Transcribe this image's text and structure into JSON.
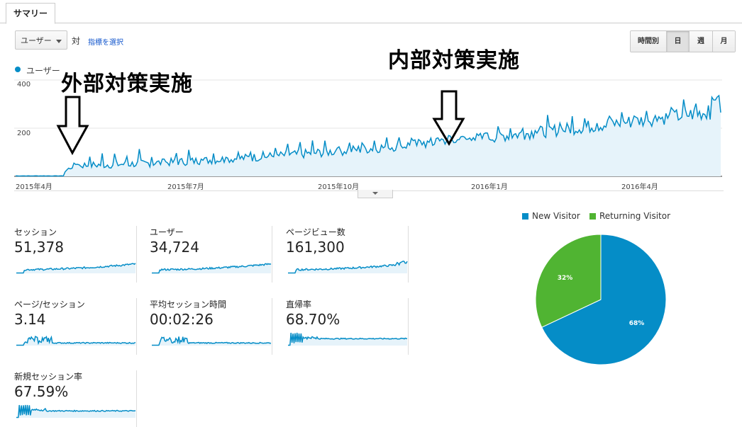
{
  "tabs": [
    {
      "label": "サマリー"
    }
  ],
  "toolbar": {
    "metric_select": "ユーザー",
    "vs_label": "対",
    "choose_metric_link": "指標を選択",
    "periods": [
      "時間別",
      "日",
      "週",
      "月"
    ],
    "active_period": "日"
  },
  "colors": {
    "line": "#058dc7",
    "fill": "#e6f3fa",
    "new_visitor": "#058dc7",
    "returning_visitor": "#50b432"
  },
  "main_chart": {
    "legend": "ユーザー",
    "y_ticks": [
      "400",
      "200"
    ],
    "x_ticks": [
      "2015年4月",
      "2015年7月",
      "2015年10月",
      "2016年1月",
      "2016年4月"
    ]
  },
  "annotations": {
    "external": "外部対策実施",
    "internal": "内部対策実施"
  },
  "metrics": [
    {
      "label": "セッション",
      "value": "51,378"
    },
    {
      "label": "ユーザー",
      "value": "34,724"
    },
    {
      "label": "ページビュー数",
      "value": "161,300"
    },
    {
      "label": "ページ/セッション",
      "value": "3.14"
    },
    {
      "label": "平均セッション時間",
      "value": "00:02:26"
    },
    {
      "label": "直帰率",
      "value": "68.70%"
    },
    {
      "label": "新規セッション率",
      "value": "67.59%"
    }
  ],
  "chart_data": {
    "type": "pie",
    "labels": [
      "New Visitor",
      "Returning Visitor"
    ],
    "values": [
      68,
      32
    ],
    "value_labels": [
      "68%",
      "32%"
    ],
    "legend": "top"
  }
}
